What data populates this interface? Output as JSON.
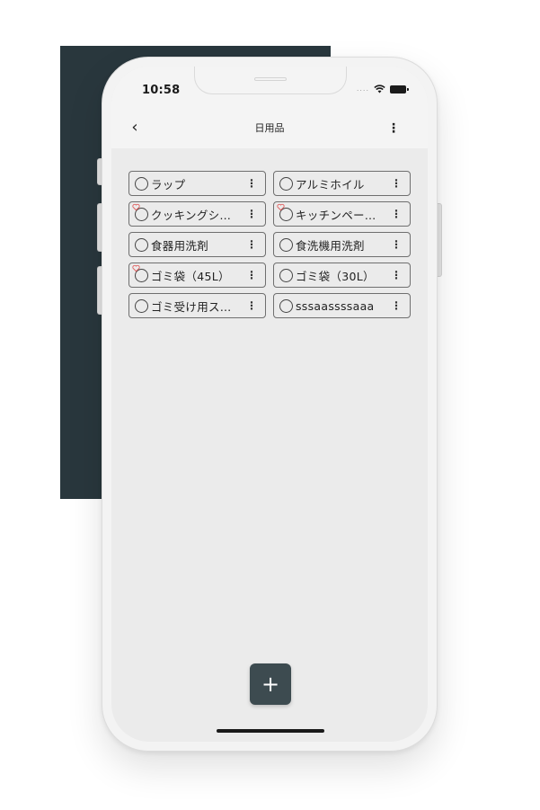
{
  "status": {
    "time": "10:58",
    "signal_dots": "....",
    "wifi_icon": "wifi-icon",
    "battery_icon": "battery-icon"
  },
  "nav": {
    "back_glyph": "‹",
    "title": "日用品",
    "menu_glyph": "⋮"
  },
  "items": [
    {
      "label": "ラップ",
      "favorite": false
    },
    {
      "label": "アルミホイル",
      "favorite": false
    },
    {
      "label": "クッキングシ…",
      "favorite": true
    },
    {
      "label": "キッチンペー…",
      "favorite": true
    },
    {
      "label": "食器用洗剤",
      "favorite": false
    },
    {
      "label": "食洗機用洗剤",
      "favorite": false
    },
    {
      "label": "ゴミ袋（45L）",
      "favorite": true
    },
    {
      "label": "ゴミ袋（30L）",
      "favorite": false
    },
    {
      "label": "ゴミ受け用ス…",
      "favorite": false
    },
    {
      "label": "sssaassssaaa",
      "favorite": false
    }
  ],
  "item_menu_glyph": "⋮",
  "fab": {
    "label": "+"
  },
  "colors": {
    "background_panel": "#29373d",
    "fab": "#3d4b50",
    "favorite_heart": "#e05a5a",
    "screen": "#ebebeb"
  }
}
